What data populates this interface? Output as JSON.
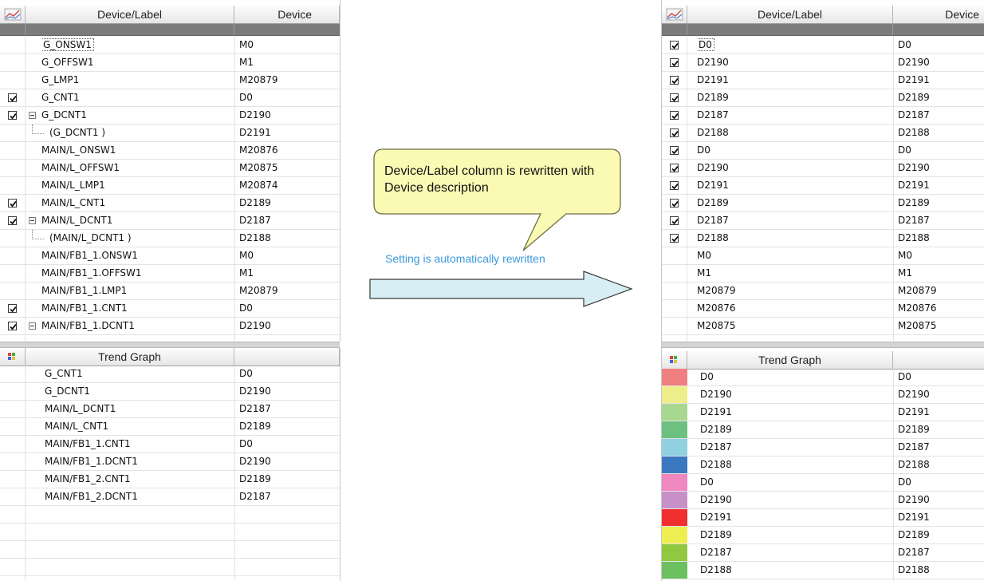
{
  "left_panel": {
    "header": {
      "label_col": "Device/Label",
      "device_col": "Device"
    },
    "rows": [
      {
        "checked": false,
        "tree": "",
        "label": "G_ONSW1",
        "device": "M0",
        "focused": true
      },
      {
        "checked": false,
        "tree": "",
        "label": "G_OFFSW1",
        "device": "M1"
      },
      {
        "checked": false,
        "tree": "",
        "label": "G_LMP1",
        "device": "M20879"
      },
      {
        "checked": true,
        "tree": "",
        "label": "G_CNT1",
        "device": "D0"
      },
      {
        "checked": true,
        "tree": "collapse",
        "label": "G_DCNT1",
        "device": "D2190"
      },
      {
        "checked": false,
        "tree": "child",
        "label": "(G_DCNT1 )",
        "device": "D2191"
      },
      {
        "checked": false,
        "tree": "",
        "label": "MAIN/L_ONSW1",
        "device": "M20876"
      },
      {
        "checked": false,
        "tree": "",
        "label": "MAIN/L_OFFSW1",
        "device": "M20875"
      },
      {
        "checked": false,
        "tree": "",
        "label": "MAIN/L_LMP1",
        "device": "M20874"
      },
      {
        "checked": true,
        "tree": "",
        "label": "MAIN/L_CNT1",
        "device": "D2189"
      },
      {
        "checked": true,
        "tree": "collapse",
        "label": "MAIN/L_DCNT1",
        "device": "D2187"
      },
      {
        "checked": false,
        "tree": "child",
        "label": "(MAIN/L_DCNT1 )",
        "device": "D2188"
      },
      {
        "checked": false,
        "tree": "",
        "label": "MAIN/FB1_1.ONSW1",
        "device": "M0"
      },
      {
        "checked": false,
        "tree": "",
        "label": "MAIN/FB1_1.OFFSW1",
        "device": "M1"
      },
      {
        "checked": false,
        "tree": "",
        "label": "MAIN/FB1_1.LMP1",
        "device": "M20879"
      },
      {
        "checked": true,
        "tree": "",
        "label": "MAIN/FB1_1.CNT1",
        "device": "D0"
      },
      {
        "checked": true,
        "tree": "collapse",
        "label": "MAIN/FB1_1.DCNT1",
        "device": "D2190"
      }
    ],
    "trend_header": {
      "label_col": "Trend Graph"
    },
    "trend_rows": [
      {
        "label": "G_CNT1",
        "device": "D0"
      },
      {
        "label": "G_DCNT1",
        "device": "D2190"
      },
      {
        "label": "MAIN/L_DCNT1",
        "device": "D2187"
      },
      {
        "label": "MAIN/L_CNT1",
        "device": "D2189"
      },
      {
        "label": "MAIN/FB1_1.CNT1",
        "device": "D0"
      },
      {
        "label": "MAIN/FB1_1.DCNT1",
        "device": "D2190"
      },
      {
        "label": "MAIN/FB1_2.CNT1",
        "device": "D2189"
      },
      {
        "label": "MAIN/FB1_2.DCNT1",
        "device": "D2187"
      },
      {
        "label": "",
        "device": ""
      },
      {
        "label": "",
        "device": ""
      },
      {
        "label": "",
        "device": ""
      },
      {
        "label": "",
        "device": ""
      },
      {
        "label": "",
        "device": ""
      }
    ]
  },
  "right_panel": {
    "header": {
      "label_col": "Device/Label",
      "device_col": "Device"
    },
    "rows": [
      {
        "checked": true,
        "label": "D0",
        "device": "D0",
        "focused": true
      },
      {
        "checked": true,
        "label": "D2190",
        "device": "D2190"
      },
      {
        "checked": true,
        "label": "D2191",
        "device": "D2191"
      },
      {
        "checked": true,
        "label": "D2189",
        "device": "D2189"
      },
      {
        "checked": true,
        "label": "D2187",
        "device": "D2187"
      },
      {
        "checked": true,
        "label": "D2188",
        "device": "D2188"
      },
      {
        "checked": true,
        "label": "D0",
        "device": "D0"
      },
      {
        "checked": true,
        "label": "D2190",
        "device": "D2190"
      },
      {
        "checked": true,
        "label": "D2191",
        "device": "D2191"
      },
      {
        "checked": true,
        "label": "D2189",
        "device": "D2189"
      },
      {
        "checked": true,
        "label": "D2187",
        "device": "D2187"
      },
      {
        "checked": true,
        "label": "D2188",
        "device": "D2188"
      },
      {
        "checked": false,
        "label": "M0",
        "device": "M0"
      },
      {
        "checked": false,
        "label": "M1",
        "device": "M1"
      },
      {
        "checked": false,
        "label": "M20879",
        "device": "M20879"
      },
      {
        "checked": false,
        "label": "M20876",
        "device": "M20876"
      },
      {
        "checked": false,
        "label": "M20875",
        "device": "M20875"
      }
    ],
    "trend_header": {
      "label_col": "Trend Graph"
    },
    "trend_rows": [
      {
        "color": "#f08080",
        "label": "D0",
        "device": "D0"
      },
      {
        "color": "#eeee8a",
        "label": "D2190",
        "device": "D2190"
      },
      {
        "color": "#a8d890",
        "label": "D2191",
        "device": "D2191"
      },
      {
        "color": "#6cc080",
        "label": "D2189",
        "device": "D2189"
      },
      {
        "color": "#90d0e0",
        "label": "D2187",
        "device": "D2187"
      },
      {
        "color": "#3a78c0",
        "label": "D2188",
        "device": "D2188"
      },
      {
        "color": "#f088c0",
        "label": "D0",
        "device": "D0"
      },
      {
        "color": "#c890c8",
        "label": "D2190",
        "device": "D2190"
      },
      {
        "color": "#f03030",
        "label": "D2191",
        "device": "D2191"
      },
      {
        "color": "#eeee50",
        "label": "D2189",
        "device": "D2189"
      },
      {
        "color": "#90c840",
        "label": "D2187",
        "device": "D2187"
      },
      {
        "color": "#6cc060",
        "label": "D2188",
        "device": "D2188"
      }
    ]
  },
  "callout": {
    "text": "Device/Label column is rewritten with Device description"
  },
  "arrow": {
    "caption": "Setting is automatically rewritten",
    "caption_color": "#3a9ad9",
    "fill": "#d6eef4"
  }
}
